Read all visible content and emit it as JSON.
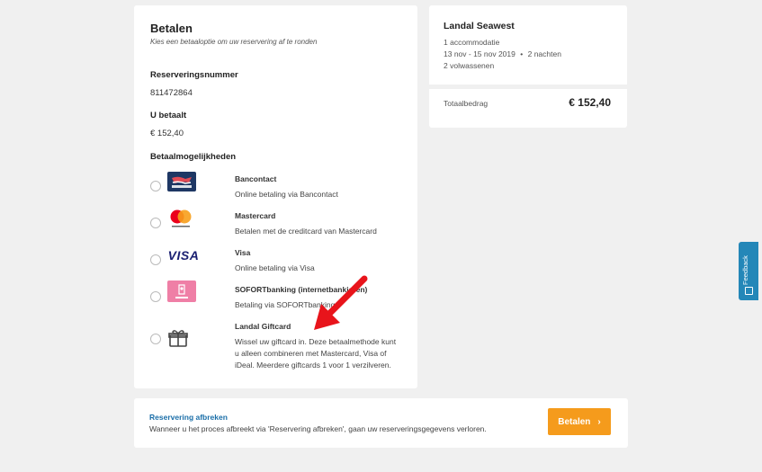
{
  "payment": {
    "title": "Betalen",
    "subtitle": "Kies een betaaloptie om uw reservering af te ronden",
    "reservation_label": "Reserveringsnummer",
    "reservation_number": "811472864",
    "due_label": "U betaalt",
    "due_amount": "€ 152,40",
    "methods_label": "Betaalmogelijkheden",
    "methods": [
      {
        "name": "Bancontact",
        "desc": "Online betaling via Bancontact",
        "icon": "bancontact-logo"
      },
      {
        "name": "Mastercard",
        "desc": "Betalen met de creditcard van Mastercard",
        "icon": "mastercard-logo"
      },
      {
        "name": "Visa",
        "desc": "Online betaling via Visa",
        "icon": "visa-logo",
        "logo_text": "VISA"
      },
      {
        "name": "SOFORTbanking (internetbankieren)",
        "desc": "Betaling via SOFORTbanking",
        "icon": "sofort-logo"
      },
      {
        "name": "Landal Giftcard",
        "desc": "Wissel uw giftcard in. Deze betaalmethode kunt u alleen combineren met Mastercard, Visa of iDeal. Meerdere giftcards 1 voor 1 verzilveren.",
        "icon": "gift-icon"
      }
    ]
  },
  "summary": {
    "title": "Landal Seawest",
    "accommodation": "1 accommodatie",
    "dates": "13 nov - 15 nov 2019",
    "nights": "2 nachten",
    "guests": "2 volwassenen",
    "total_label": "Totaalbedrag",
    "total_value": "€ 152,40"
  },
  "footer": {
    "cancel_link": "Reservering afbreken",
    "cancel_text": "Wanneer u het proces afbreekt via 'Reservering afbreken', gaan uw reserveringsgegevens verloren.",
    "pay_button": "Betalen",
    "pay_arrow": "›"
  },
  "feedback": {
    "label": "Feedback"
  },
  "colors": {
    "accent": "#f59b1c",
    "link": "#1a6ea8",
    "feedback": "#2487b8",
    "arrow": "#e8141b"
  }
}
